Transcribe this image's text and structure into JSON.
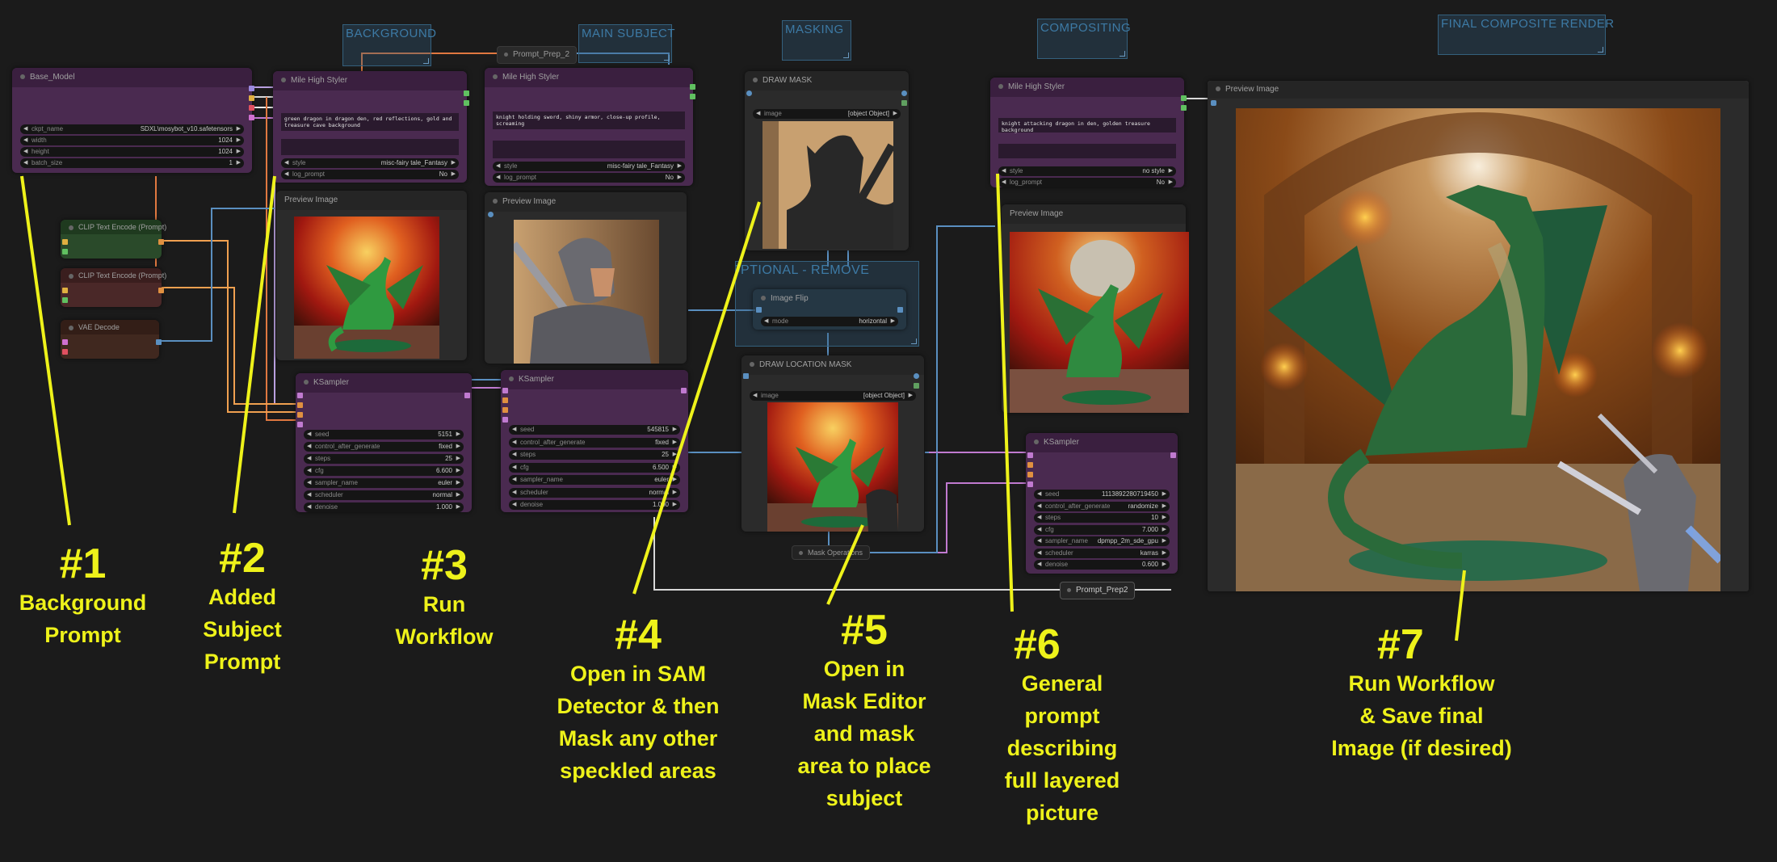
{
  "groups": {
    "background": "BACKGROUND",
    "main_subject": "MAIN SUBJECT",
    "masking": "MASKING",
    "optional_remove": "OPTIONAL - REMOVE",
    "compositing": "COMPOSITING",
    "final_render": "FINAL COMPOSITE RENDER"
  },
  "nodes": {
    "base_model": {
      "title": "Base_Model",
      "widgets": [
        {
          "label": "ckpt_name",
          "value": "SDXL\\mosybot_v10.safetensors"
        },
        {
          "label": "width",
          "value": "1024"
        },
        {
          "label": "height",
          "value": "1024"
        },
        {
          "label": "batch_size",
          "value": "1"
        }
      ]
    },
    "prompt_prep_2": {
      "title": "Prompt_Prep_2"
    },
    "clip_pos": {
      "title": "CLIP Text Encode (Prompt)"
    },
    "clip_neg": {
      "title": "CLIP Text Encode (Prompt)"
    },
    "vae_decode": {
      "title": "VAE Decode"
    },
    "styler_bg": {
      "title": "Mile High Styler",
      "prompt": "green dragon in dragon den, red reflections, gold and treasure cave background",
      "widgets": [
        {
          "label": "style",
          "value": "misc-fairy tale_Fantasy"
        },
        {
          "label": "log_prompt",
          "value": "No"
        }
      ]
    },
    "styler_subject": {
      "title": "Mile High Styler",
      "prompt": "knight holding sword, shiny armor, close-up profile, screaming",
      "widgets": [
        {
          "label": "style",
          "value": "misc-fairy tale_Fantasy"
        },
        {
          "label": "log_prompt",
          "value": "No"
        }
      ]
    },
    "preview_bg": {
      "title": "Preview Image"
    },
    "preview_subject": {
      "title": "Preview Image"
    },
    "ksampler_bg": {
      "title": "KSampler",
      "widgets": [
        {
          "label": "seed",
          "value": "5151"
        },
        {
          "label": "control_after_generate",
          "value": "fixed"
        },
        {
          "label": "steps",
          "value": "25"
        },
        {
          "label": "cfg",
          "value": "6.600"
        },
        {
          "label": "sampler_name",
          "value": "euler"
        },
        {
          "label": "scheduler",
          "value": "normal"
        },
        {
          "label": "denoise",
          "value": "1.000"
        }
      ]
    },
    "ksampler_subject": {
      "title": "KSampler",
      "widgets": [
        {
          "label": "seed",
          "value": "545815"
        },
        {
          "label": "control_after_generate",
          "value": "fixed"
        },
        {
          "label": "steps",
          "value": "25"
        },
        {
          "label": "cfg",
          "value": "6.500"
        },
        {
          "label": "sampler_name",
          "value": "euler"
        },
        {
          "label": "scheduler",
          "value": "normal"
        },
        {
          "label": "denoise",
          "value": "1.000"
        }
      ]
    },
    "draw_mask": {
      "title": "DRAW MASK",
      "widgets": [
        {
          "label": "image",
          "value": "[object Object]"
        }
      ]
    },
    "image_flip": {
      "title": "Image Flip",
      "widgets": [
        {
          "label": "mode",
          "value": "horizontal"
        }
      ]
    },
    "draw_location_mask": {
      "title": "DRAW LOCATION MASK",
      "widgets": [
        {
          "label": "image",
          "value": "[object Object]"
        }
      ]
    },
    "mask_operations": {
      "title": "Mask Operations"
    },
    "styler_comp": {
      "title": "Mile High Styler",
      "prompt": "knight attacking dragon in den, golden treasure background",
      "widgets": [
        {
          "label": "style",
          "value": "no style"
        },
        {
          "label": "log_prompt",
          "value": "No"
        }
      ]
    },
    "preview_comp": {
      "title": "Preview Image"
    },
    "ksampler_comp": {
      "title": "KSampler",
      "widgets": [
        {
          "label": "seed",
          "value": "1113892280719450"
        },
        {
          "label": "control_after_generate",
          "value": "randomize"
        },
        {
          "label": "steps",
          "value": "10"
        },
        {
          "label": "cfg",
          "value": "7.000"
        },
        {
          "label": "sampler_name",
          "value": "dpmpp_2m_sde_gpu"
        },
        {
          "label": "scheduler",
          "value": "karras"
        },
        {
          "label": "denoise",
          "value": "0.600"
        }
      ]
    },
    "prompt_prep2": {
      "title": "Prompt_Prep2"
    },
    "preview_final": {
      "title": "Preview Image"
    }
  },
  "annotations": [
    {
      "num": "#1",
      "text": "Background\nPrompt"
    },
    {
      "num": "#2",
      "text": "Added\nSubject\nPrompt"
    },
    {
      "num": "#3",
      "text": "Run\nWorkflow"
    },
    {
      "num": "#4",
      "text": "Open in SAM\nDetector & then\nMask any other\nspeckled areas"
    },
    {
      "num": "#5",
      "text": "Open in\nMask Editor\nand mask\narea to place\nsubject"
    },
    {
      "num": "#6",
      "text": "General\nprompt\ndescribing\nfull layered\npicture"
    },
    {
      "num": "#7",
      "text": "Run Workflow\n& Save final\nImage (if desired)"
    }
  ],
  "colors": {
    "annotation_yellow": "#eef21a",
    "canvas_bg": "#1b1b1b",
    "node_purple": "#4a2a50",
    "group_blue": "#3d7aa5"
  }
}
